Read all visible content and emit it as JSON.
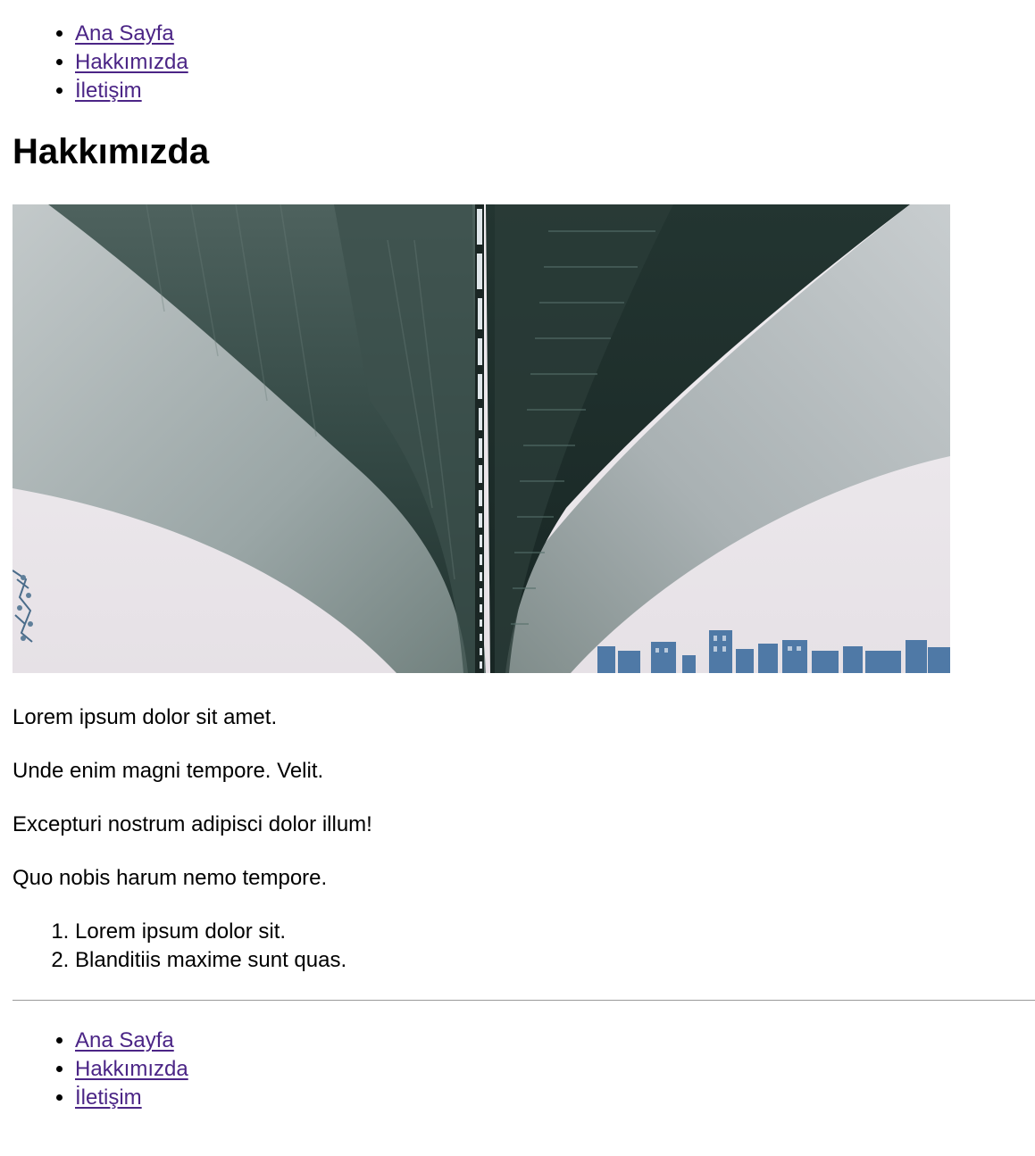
{
  "nav_top": {
    "items": [
      "Ana Sayfa",
      "Hakkımızda",
      "İletişim"
    ]
  },
  "page_title": "Hakkımızda",
  "hero_image": {
    "description_name": "bridge-underside-photo",
    "colors": {
      "sky": "#ece8ec",
      "deck_dark": "#2f4742",
      "deck_mid": "#5b706c",
      "pylon_light": "#b7bec0",
      "city": "#4f79a6"
    }
  },
  "paragraphs": [
    "Lorem ipsum dolor sit amet.",
    "Unde enim magni tempore. Velit.",
    "Excepturi nostrum adipisci dolor illum!",
    "Quo nobis harum nemo tempore."
  ],
  "ordered_list": [
    "Lorem ipsum dolor sit.",
    "Blanditiis maxime sunt quas."
  ],
  "nav_bottom": {
    "items": [
      "Ana Sayfa",
      "Hakkımızda",
      "İletişim"
    ]
  },
  "colors": {
    "link": "#4b2586",
    "text": "#000000",
    "divider": "#9a9a9a"
  }
}
